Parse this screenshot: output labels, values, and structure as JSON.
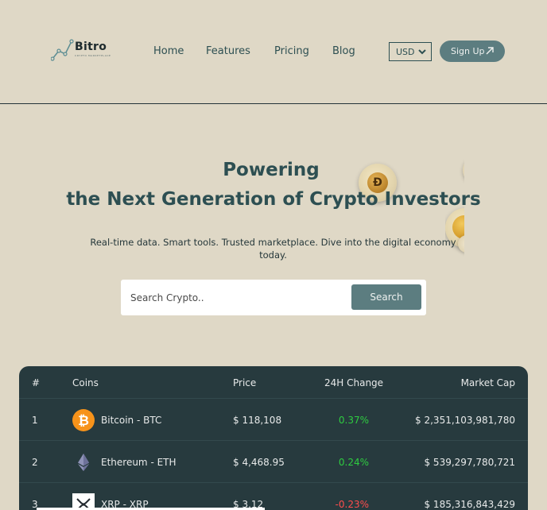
{
  "brand": {
    "name": "Bitro",
    "tagline": "CRYPTO MARKETPLACE"
  },
  "nav": [
    "Home",
    "Features",
    "Pricing",
    "Blog"
  ],
  "currency": {
    "selected": "USD"
  },
  "signup_label": "Sign Up",
  "hero": {
    "title_line1": "Powering",
    "title_line2": "the Next Generation of Crypto Investors",
    "subtitle": "Real-time data. Smart tools. Trusted marketplace. Dive into the digital economy today.",
    "coin_letter": "Đ"
  },
  "search": {
    "placeholder": "Search Crypto..",
    "button_label": "Search"
  },
  "table": {
    "headers": [
      "#",
      "Coins",
      "Price",
      "24H Change",
      "Market Cap"
    ],
    "rows": [
      {
        "rank": "1",
        "name": "Bitcoin - BTC",
        "price": "$ 118,108",
        "change": "0.37%",
        "market_cap": "$ 2,351,103,981,780",
        "icon": "bitcoin-icon",
        "change_color": "#2ecc40"
      },
      {
        "rank": "2",
        "name": "Ethereum - ETH",
        "price": "$ 4,468.95",
        "change": "0.24%",
        "market_cap": "$ 539,297,780,721",
        "icon": "ethereum-icon",
        "change_color": "#2ecc40"
      },
      {
        "rank": "3",
        "name": "XRP - XRP",
        "price": "$ 3.12",
        "change": "-0.23%",
        "market_cap": "$ 185,316,843,429",
        "icon": "xrp-icon",
        "change_color": "#ff4d4d"
      }
    ]
  },
  "colors": {
    "background": "#dfd8c6",
    "accent": "#5c7d80",
    "heading": "#2d4f52",
    "table_bg": "#273a3e",
    "positive": "#2ecc40",
    "negative": "#ff4d4d"
  }
}
